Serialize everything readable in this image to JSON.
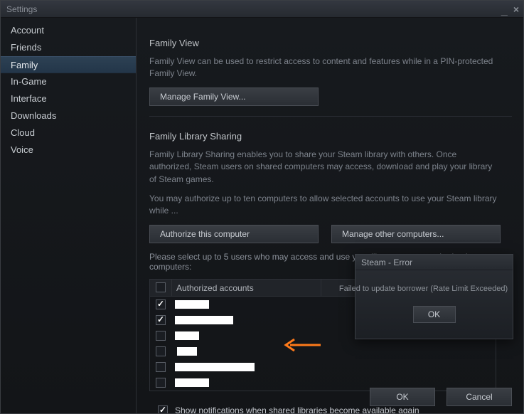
{
  "window": {
    "title": "Settings"
  },
  "sidebar": {
    "items": [
      {
        "label": "Account"
      },
      {
        "label": "Friends"
      },
      {
        "label": "Family"
      },
      {
        "label": "In-Game"
      },
      {
        "label": "Interface"
      },
      {
        "label": "Downloads"
      },
      {
        "label": "Cloud"
      },
      {
        "label": "Voice"
      }
    ],
    "selected_index": 2
  },
  "family_view": {
    "title": "Family View",
    "desc": "Family View can be used to restrict access to content and features while in a PIN-protected Family View.",
    "manage_btn": "Manage Family View..."
  },
  "sharing": {
    "title": "Family Library Sharing",
    "desc1": "Family Library Sharing enables you to share your Steam library with others. Once authorized, Steam users on shared computers may access, download and play your library of Steam games.",
    "desc2": "You may authorize up to ten computers to allow selected accounts to use your Steam library while ...",
    "authorize_btn": "Authorize this computer",
    "manage_btn": "Manage other computers...",
    "select_note": "Please select up to 5 users who may access and use your library on your authorized computers:",
    "th_label": "Authorized accounts",
    "rows": [
      {
        "checked": true
      },
      {
        "checked": true
      },
      {
        "checked": false
      },
      {
        "checked": false
      },
      {
        "checked": false
      },
      {
        "checked": false
      }
    ]
  },
  "notif": {
    "label": "Show notifications when shared libraries become available again",
    "checked": true
  },
  "footer": {
    "ok": "OK",
    "cancel": "Cancel"
  },
  "error": {
    "title": "Steam - Error",
    "message": "Failed to update borrower (Rate Limit Exceeded)",
    "ok": "OK"
  }
}
